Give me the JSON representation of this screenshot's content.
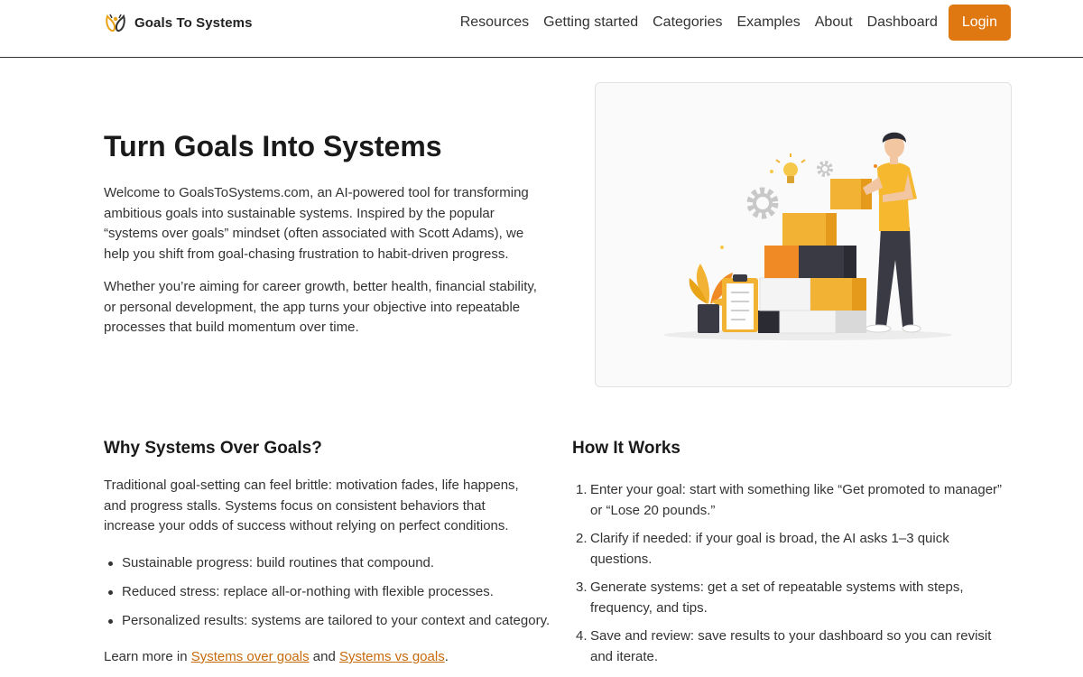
{
  "header": {
    "brand": "Goals To Systems",
    "nav": [
      "Resources",
      "Getting started",
      "Categories",
      "Examples",
      "About",
      "Dashboard"
    ],
    "login": "Login"
  },
  "hero": {
    "title": "Turn Goals Into Systems",
    "p1": "Welcome to GoalsToSystems.com, an AI-powered tool for transforming ambitious goals into sustainable systems. Inspired by the popular “systems over goals” mindset (often associated with Scott Adams), we help you shift from goal-chasing frustration to habit-driven progress.",
    "p2": "Whether you’re aiming for career growth, better health, financial stability, or personal development, the app turns your objective into repeatable processes that build momentum over time."
  },
  "why": {
    "title": "Why Systems Over Goals?",
    "para": "Traditional goal-setting can feel brittle: motivation fades, life happens, and progress stalls. Systems focus on consistent behaviors that increase your odds of success without relying on perfect conditions.",
    "bullets": [
      "Sustainable progress: build routines that compound.",
      "Reduced stress: replace all-or-nothing with flexible processes.",
      "Personalized results: systems are tailored to your context and category."
    ],
    "learn_prefix": "Learn more in ",
    "link1": "Systems over goals",
    "learn_and": " and ",
    "link2": "Systems vs goals",
    "learn_suffix": "."
  },
  "how": {
    "title": "How It Works",
    "steps": [
      {
        "num": "1.",
        "text": "Enter your goal: start with something like “Get promoted to manager” or “Lose 20 pounds.”"
      },
      {
        "num": "2.",
        "text": "Clarify if needed: if your goal is broad, the AI asks 1–3 quick questions."
      },
      {
        "num": "3.",
        "text": "Generate systems: get a set of repeatable systems with steps, frequency, and tips."
      },
      {
        "num": "4.",
        "text": "Save and review: save results to your dashboard so you can revisit and iterate."
      }
    ]
  },
  "colors": {
    "accent": "#e07811",
    "link": "#c76a0a",
    "box_orange": "#f08a24",
    "box_yellow": "#f2b233",
    "box_dark": "#3a3a44",
    "shirt": "#f5b82e"
  },
  "icons": [
    "brand-logo-icon",
    "lightbulb-icon",
    "gear-icon",
    "plant-icon",
    "clipboard-icon"
  ]
}
